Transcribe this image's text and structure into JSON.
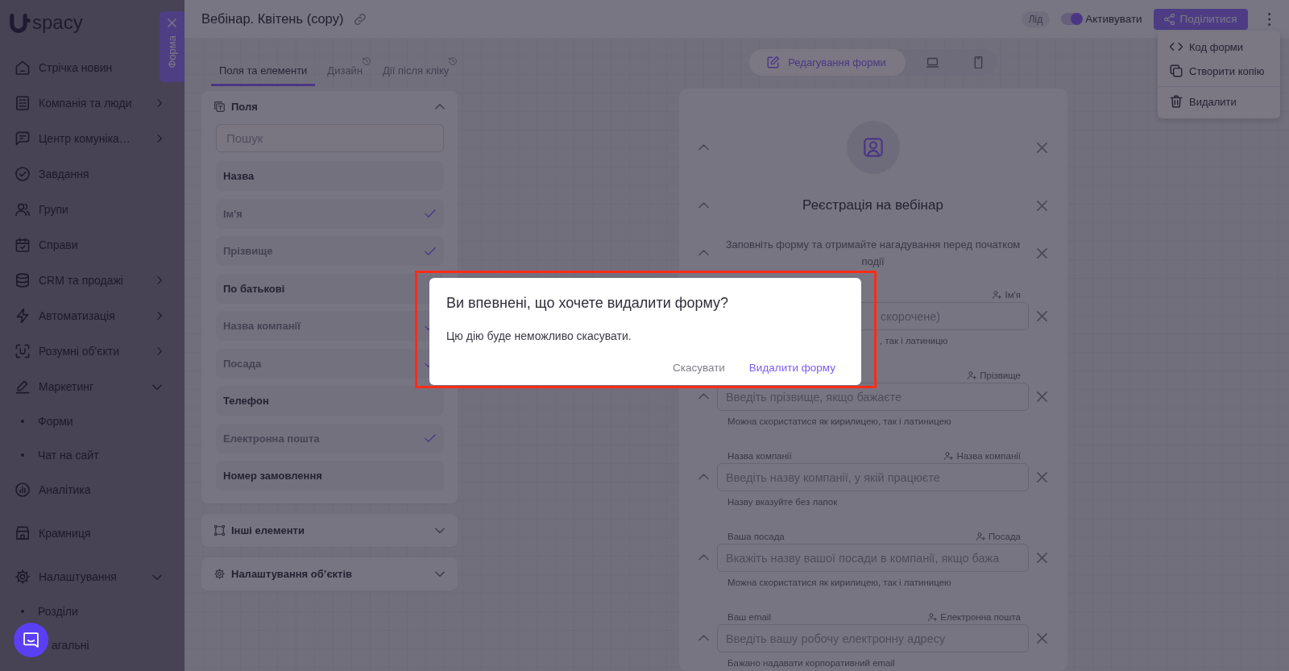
{
  "sidebar": {
    "logo": "spacy",
    "items": [
      {
        "label": "Стрічка новин",
        "kind": "link"
      },
      {
        "label": "Компанія та люди",
        "kind": "group",
        "expanded": false
      },
      {
        "label": "Центр комуніка…",
        "kind": "group",
        "expanded": false
      },
      {
        "label": "Завдання",
        "kind": "link"
      },
      {
        "label": "Групи",
        "kind": "link"
      },
      {
        "label": "Справи",
        "kind": "link"
      },
      {
        "label": "CRM та продажі",
        "kind": "group",
        "expanded": false
      },
      {
        "label": "Автоматизація",
        "kind": "group",
        "expanded": false
      },
      {
        "label": "Розумні об'єкти",
        "kind": "group",
        "expanded": false
      },
      {
        "label": "Маркетинг",
        "kind": "group",
        "expanded": true,
        "children": [
          {
            "label": "Форми"
          },
          {
            "label": "Чат на сайт"
          }
        ]
      },
      {
        "label": "Аналітика",
        "kind": "link"
      },
      {
        "label": "Крамниця",
        "kind": "link"
      },
      {
        "label": "Налаштування",
        "kind": "group",
        "expanded": true,
        "children": [
          {
            "label": "Розділи"
          },
          {
            "label": "агальні"
          }
        ]
      }
    ]
  },
  "drawer_tab": {
    "label": "Форма"
  },
  "header": {
    "title": "Вебінар. Квітень (copy)",
    "badge": "Лід",
    "toggle": {
      "label": "Активувати",
      "on": true
    },
    "share_button": "Поділитися"
  },
  "menu": {
    "items": [
      {
        "label": "Код форми",
        "kind": "code"
      },
      {
        "label": "Створити копію",
        "kind": "copy"
      },
      {
        "label": "Видалити",
        "kind": "delete"
      }
    ]
  },
  "tabs": [
    {
      "label": "Поля та елементи",
      "selected": true,
      "disabled": false
    },
    {
      "label": "Дизайн",
      "selected": false,
      "disabled": true
    },
    {
      "label": "Дії після кліку",
      "selected": false,
      "disabled": true
    }
  ],
  "fields_panel": {
    "title": "Поля",
    "expanded": true,
    "search": {
      "placeholder": "Пошук"
    },
    "items": [
      {
        "label": "Назва",
        "checked": false
      },
      {
        "label": "Ім'я",
        "checked": true
      },
      {
        "label": "Прізвище",
        "checked": true
      },
      {
        "label": "По батькові",
        "checked": false
      },
      {
        "label": "Назва компанії",
        "checked": true
      },
      {
        "label": "Посада",
        "checked": true
      },
      {
        "label": "Телефон",
        "checked": false
      },
      {
        "label": "Електронна пошта",
        "checked": true
      },
      {
        "label": "Номер замовлення",
        "checked": false
      }
    ]
  },
  "other_panels": [
    {
      "title": "Інші елементи",
      "expanded": false
    },
    {
      "title": "Налаштування об’єктів",
      "expanded": false
    }
  ],
  "preview_toolbar": {
    "modes": [
      {
        "label": "Редагування форми",
        "kind": "edit",
        "selected": true
      },
      {
        "kind": "desktop",
        "selected": false
      },
      {
        "kind": "mobile",
        "selected": false
      }
    ]
  },
  "form": {
    "title": "Реєстрація на вебінар",
    "description": "Заповніть форму та отримайте нагадування перед початком події",
    "fields": [
      {
        "mapped_to": "Ім'я",
        "placeholder": "скорочене)",
        "hint": ", так і латиницю"
      },
      {
        "mapped_to": "Прізвище",
        "placeholder": "Введіть прізвище, якщо бажаєте",
        "hint": "Можна скористатися як кирилицею, так і латиницею"
      },
      {
        "label": "Назва компанії",
        "mapped_to": "Назва компанії",
        "placeholder": "Введіть назву компанії, у якій працюєте",
        "hint": "Назву вказуйте без лапок"
      },
      {
        "label": "Ваша посада",
        "mapped_to": "Посада",
        "placeholder": "Вкажіть назву вашої посади в компанії, якщо бажа",
        "hint": "Можна скористатися як кирилицею, так і латиницею"
      },
      {
        "label": "Ваш email",
        "mapped_to": "Електронна пошта",
        "placeholder": "Введіть вашу робочу електронну адресу",
        "hint": "Бажано надавати корпоративний email"
      }
    ]
  },
  "dialog": {
    "highlighted": true,
    "title": "Ви впевнені, що хочете видалити форму?",
    "message": "Цю дію буде неможливо скасувати.",
    "buttons": [
      {
        "label": "Скасувати",
        "kind": "secondary"
      },
      {
        "label": "Видалити форму",
        "kind": "primary"
      }
    ]
  }
}
